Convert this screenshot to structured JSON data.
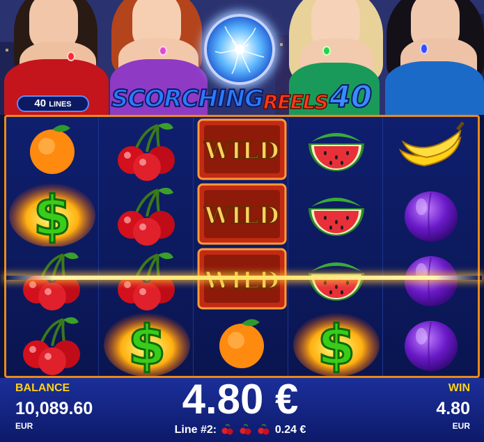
{
  "header": {
    "lines_number": "40",
    "lines_word": "LINES",
    "logo_part1": "SCORCHING",
    "logo_part2": "REELS",
    "logo_part3": "40"
  },
  "reels": [
    [
      "orange",
      "dollar",
      "cherry",
      "cherry"
    ],
    [
      "cherry",
      "cherry",
      "cherry",
      "dollar"
    ],
    [
      "wild",
      "wild",
      "wild",
      "orange"
    ],
    [
      "watermelon",
      "watermelon",
      "watermelon",
      "dollar"
    ],
    [
      "banana",
      "plum",
      "plum",
      "plum"
    ]
  ],
  "wild_text": "WILD",
  "footer": {
    "balance_label": "BALANCE",
    "balance_value": "10,089.60",
    "balance_currency": "EUR",
    "total_win": "4.80 €",
    "line_prefix": "Line #2:",
    "line_amount": "0.24 €",
    "win_label": "WIN",
    "win_value": "4.80",
    "win_currency": "EUR"
  },
  "colors": {
    "accent_yellow": "#ffd21a",
    "frame_orange": "#e98a1a",
    "panel_blue": "#1b2f9a"
  }
}
